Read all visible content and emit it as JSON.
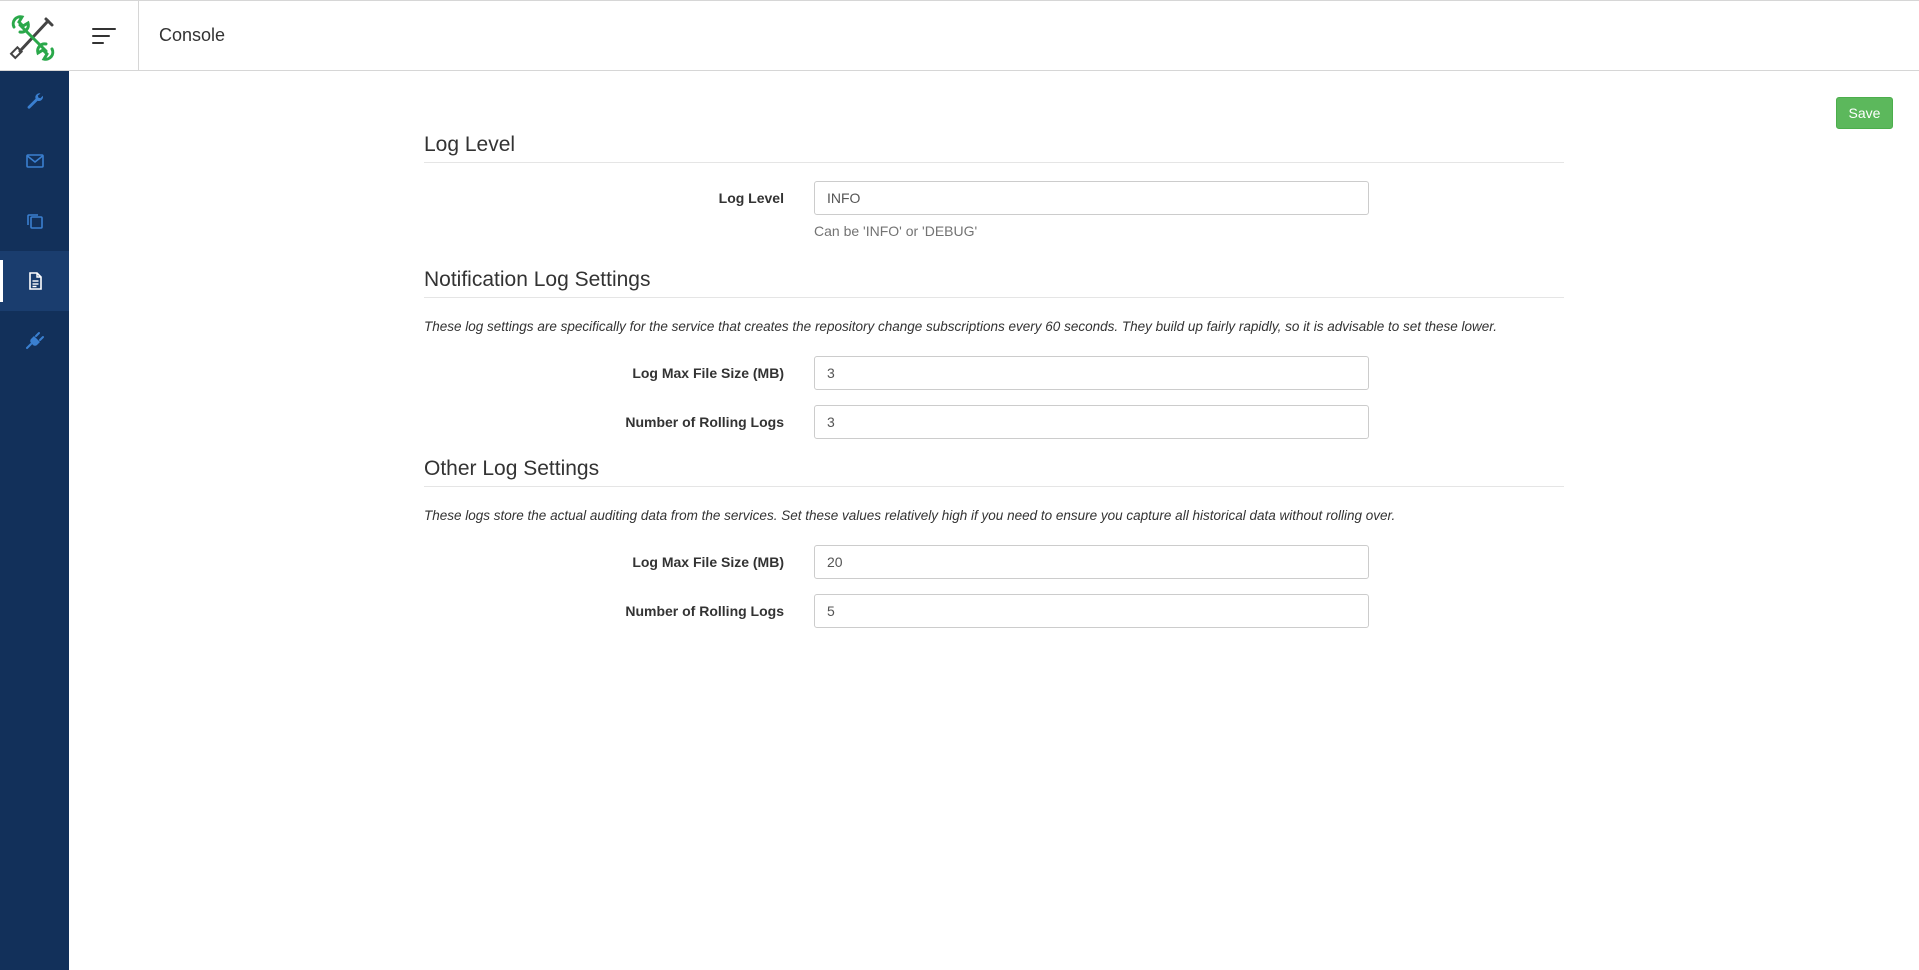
{
  "header": {
    "title": "Console"
  },
  "sidebar": {
    "items": [
      {
        "icon": "wrench-icon",
        "active": false
      },
      {
        "icon": "envelope-icon",
        "active": false
      },
      {
        "icon": "copy-icon",
        "active": false
      },
      {
        "icon": "file-icon",
        "active": true
      },
      {
        "icon": "plug-icon",
        "active": false
      }
    ]
  },
  "toolbar": {
    "save_label": "Save"
  },
  "log_level": {
    "title": "Log Level",
    "label": "Log Level",
    "value": "INFO",
    "help": "Can be 'INFO' or 'DEBUG'"
  },
  "notification": {
    "title": "Notification Log Settings",
    "description": "These log settings are specifically for the service that creates the repository change subscriptions every 60 seconds. They build up fairly rapidly, so it is advisable to set these lower.",
    "max_size_label": "Log Max File Size (MB)",
    "max_size_value": "3",
    "rolling_label": "Number of Rolling Logs",
    "rolling_value": "3"
  },
  "other": {
    "title": "Other Log Settings",
    "description": "These logs store the actual auditing data from the services. Set these values relatively high if you need to ensure you capture all historical data without rolling over.",
    "max_size_label": "Log Max File Size (MB)",
    "max_size_value": "20",
    "rolling_label": "Number of Rolling Logs",
    "rolling_value": "5"
  },
  "colors": {
    "sidebar": "#12305a",
    "sidebar_active": "#1a3d6e",
    "icon": "#3a7fd0",
    "save": "#5cb85c",
    "logo_green": "#2aa84a"
  }
}
